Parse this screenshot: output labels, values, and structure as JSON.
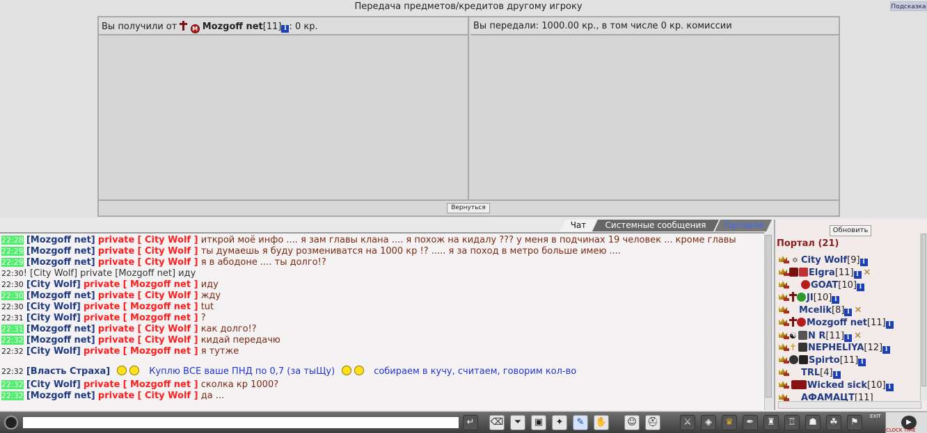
{
  "top": {
    "title": "Передача предметов/кредитов другому игроку",
    "hint_label": "Подсказка",
    "received": {
      "prefix": "Вы получили от",
      "sender_name": "Mozgoff net",
      "sender_level": "[11]",
      "info_glyph": "i",
      "suffix": ": 0 кр.",
      "clan_badge": "M"
    },
    "sent": "Вы передали: 1000.00 кр., в том числе 0 кр. комиссии",
    "back_label": "Вернуться"
  },
  "chat": {
    "tabs": [
      {
        "label": "Чат"
      },
      {
        "label": "Системные сообщения"
      },
      {
        "label": "Торговля"
      }
    ],
    "colors": {
      "highlight": "#4cf06a",
      "nick": "#1f3a83",
      "private": "#ff1d1d",
      "message": "#7b2a12",
      "trade": "#2233cc"
    },
    "private_word": "private",
    "lines": [
      {
        "time": "22:28",
        "from": "[Mozgoff net]",
        "to": "[ City Wolf ]",
        "text": "иткрой моё инфо .... я зам главы клана .... я похож на кидалу ??? у меня в подчинах 19 человек ... кроме главы"
      },
      {
        "time": "22:29",
        "from": "[Mozgoff net]",
        "to": "[ City Wolf ]",
        "text": "ты думаешь я буду розмениватся на 1000 кр !? ..... я за поход в метро больше имею ...."
      },
      {
        "time": "22:29",
        "from": "[Mozgoff net]",
        "to": "[ City Wolf ]",
        "text": "я в абодоне .... ты долго!?"
      },
      {
        "time": "22:30",
        "self_line": "! [City Wolf] private [Mozgoff net] иду"
      },
      {
        "time": "22:30",
        "from": "[City Wolf]",
        "to": "[ Mozgoff net ]",
        "text": "иду"
      },
      {
        "time": "22:30",
        "from": "[Mozgoff net]",
        "to": "[ City Wolf ]",
        "text": "жду"
      },
      {
        "time": "22:30",
        "from": "[City Wolf]",
        "to": "[ Mozgoff net ]",
        "text": "tut"
      },
      {
        "time": "22:31",
        "from": "[City Wolf]",
        "to": "[ Mozgoff net ]",
        "text": "?"
      },
      {
        "time": "22:31",
        "from": "[Mozgoff net]",
        "to": "[ City Wolf ]",
        "text": "как долго!?"
      },
      {
        "time": "22:32",
        "from": "[Mozgoff net]",
        "to": "[ City Wolf ]",
        "text": "кидай передачю"
      },
      {
        "time": "22:32",
        "from": "[City Wolf]",
        "to": "[ Mozgoff net ]",
        "text": "я тутже"
      }
    ],
    "trade_line": {
      "time": "22:32",
      "from": "[Власть Страха]",
      "part1": "Куплю ВСЕ ваше ПНД по 0,7 (за тыЩу)",
      "part2": "собираем в кучу, считаем, говорим кол-во"
    },
    "tail_lines": [
      {
        "time": "22:32",
        "from": "[City Wolf]",
        "to": "[ Mozgoff net ]",
        "text": "сколка кр 1000?"
      },
      {
        "time": "22:32",
        "from": "[Mozgoff net]",
        "to": "[ City Wolf ]",
        "text": "да ..."
      }
    ]
  },
  "online": {
    "refresh_label": "Обновить",
    "room": "Портал (21)",
    "users": [
      {
        "name": "City Wolf",
        "level": "[9]"
      },
      {
        "name": "Elgra",
        "level": "[11]"
      },
      {
        "name": "GOAT",
        "level": "[10]"
      },
      {
        "name": "JI",
        "level": "[10]"
      },
      {
        "name": "Mcelik",
        "level": "[8]"
      },
      {
        "name": "Mozgoff net",
        "level": "[11]"
      },
      {
        "name": "N R",
        "level": "[11]"
      },
      {
        "name": "NEPHELIYA",
        "level": "[12]"
      },
      {
        "name": "Spirto",
        "level": "[11]"
      },
      {
        "name": "TRL",
        "level": "[4]"
      },
      {
        "name": "Wicked sick",
        "level": "[10]"
      },
      {
        "name": "АФАМАЦТ",
        "level": "[11]"
      }
    ]
  },
  "toolbar": {
    "input_value": "",
    "exit_label": "EXIT",
    "clock_label": "CLOCK TIME",
    "icons": [
      "enter-icon",
      "eraser-icon",
      "filter-icon",
      "monitor-icon",
      "walk-icon",
      "translit-icon",
      "hand-icon",
      "smiley-icon",
      "helmet-icon",
      "sword-icon",
      "bag-icon",
      "gold-icon",
      "scroll-icon",
      "armor-icon",
      "castle-icon",
      "group-icon",
      "party-icon",
      "flag-icon"
    ]
  }
}
